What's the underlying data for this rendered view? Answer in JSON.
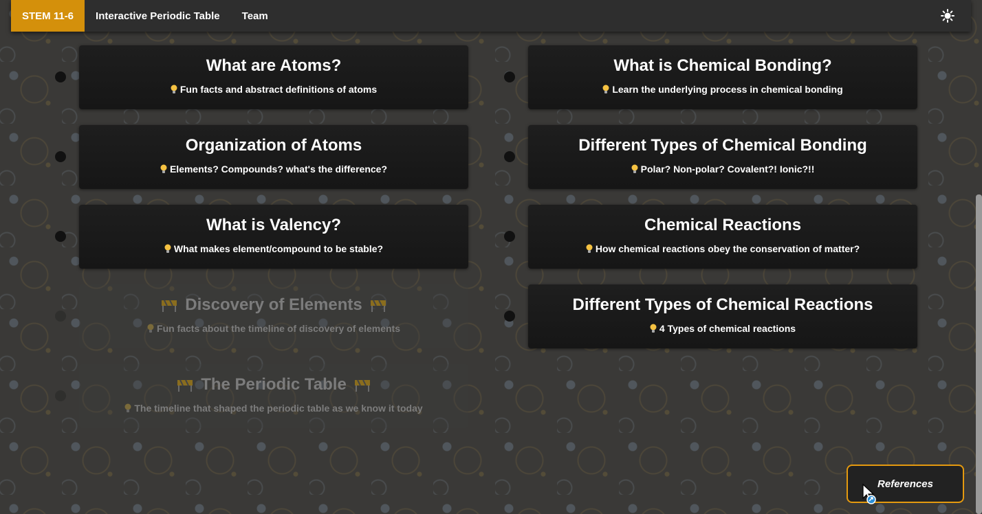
{
  "nav": {
    "brand": "STEM 11-6",
    "links": [
      "Interactive Periodic Table",
      "Team"
    ],
    "theme_icon": "sun-icon"
  },
  "cards_left": [
    {
      "title": "What are Atoms?",
      "subtitle": "Fun facts and abstract definitions of atoms",
      "disabled": false
    },
    {
      "title": "Organization of Atoms",
      "subtitle": "Elements? Compounds? what's the difference?",
      "disabled": false
    },
    {
      "title": "What is Valency?",
      "subtitle": "What makes element/compound to be stable?",
      "disabled": false
    },
    {
      "title": "Discovery of Elements",
      "subtitle": "Fun facts about the timeline of discovery of elements",
      "disabled": true
    },
    {
      "title": "The Periodic Table",
      "subtitle": "The timeline that shaped the periodic table as we know it today",
      "disabled": true
    }
  ],
  "cards_right": [
    {
      "title": "What is Chemical Bonding?",
      "subtitle": "Learn the underlying process in chemical bonding",
      "disabled": false
    },
    {
      "title": "Different Types of Chemical Bonding",
      "subtitle": "Polar? Non-polar? Covalent?! Ionic?!!",
      "disabled": false
    },
    {
      "title": "Chemical Reactions",
      "subtitle": "How chemical reactions obey the conservation of matter?",
      "disabled": false
    },
    {
      "title": "Different Types of Chemical Reactions",
      "subtitle": "4 Types of chemical reactions",
      "disabled": false
    }
  ],
  "references_label": "References",
  "colors": {
    "accent": "#d4900b",
    "card": "#1a1a1a"
  }
}
